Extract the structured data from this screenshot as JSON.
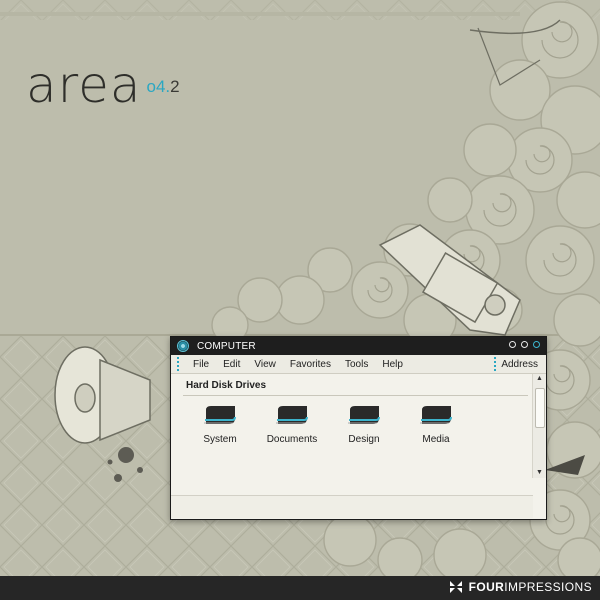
{
  "desktop": {
    "brand": {
      "name": "area",
      "version_major": "o4",
      "version_dot": ".",
      "version_minor": "2"
    }
  },
  "window": {
    "title": "COMPUTER",
    "menu": [
      "File",
      "Edit",
      "View",
      "Favorites",
      "Tools",
      "Help"
    ],
    "address_label": "Address",
    "section_title": "Hard Disk Drives",
    "drives": [
      {
        "label": "System",
        "icon": "hard-drive-icon"
      },
      {
        "label": "Documents",
        "icon": "hard-drive-icon"
      },
      {
        "label": "Design",
        "icon": "hard-drive-icon"
      },
      {
        "label": "Media",
        "icon": "hard-drive-icon"
      }
    ]
  },
  "footer": {
    "brand_bold": "FOUR",
    "brand_light": "IMPRESSIONS"
  },
  "colors": {
    "background": "#bdbdac",
    "accent": "#2aa7c2",
    "window_bar": "#1e1e1e",
    "footer": "#262626"
  }
}
